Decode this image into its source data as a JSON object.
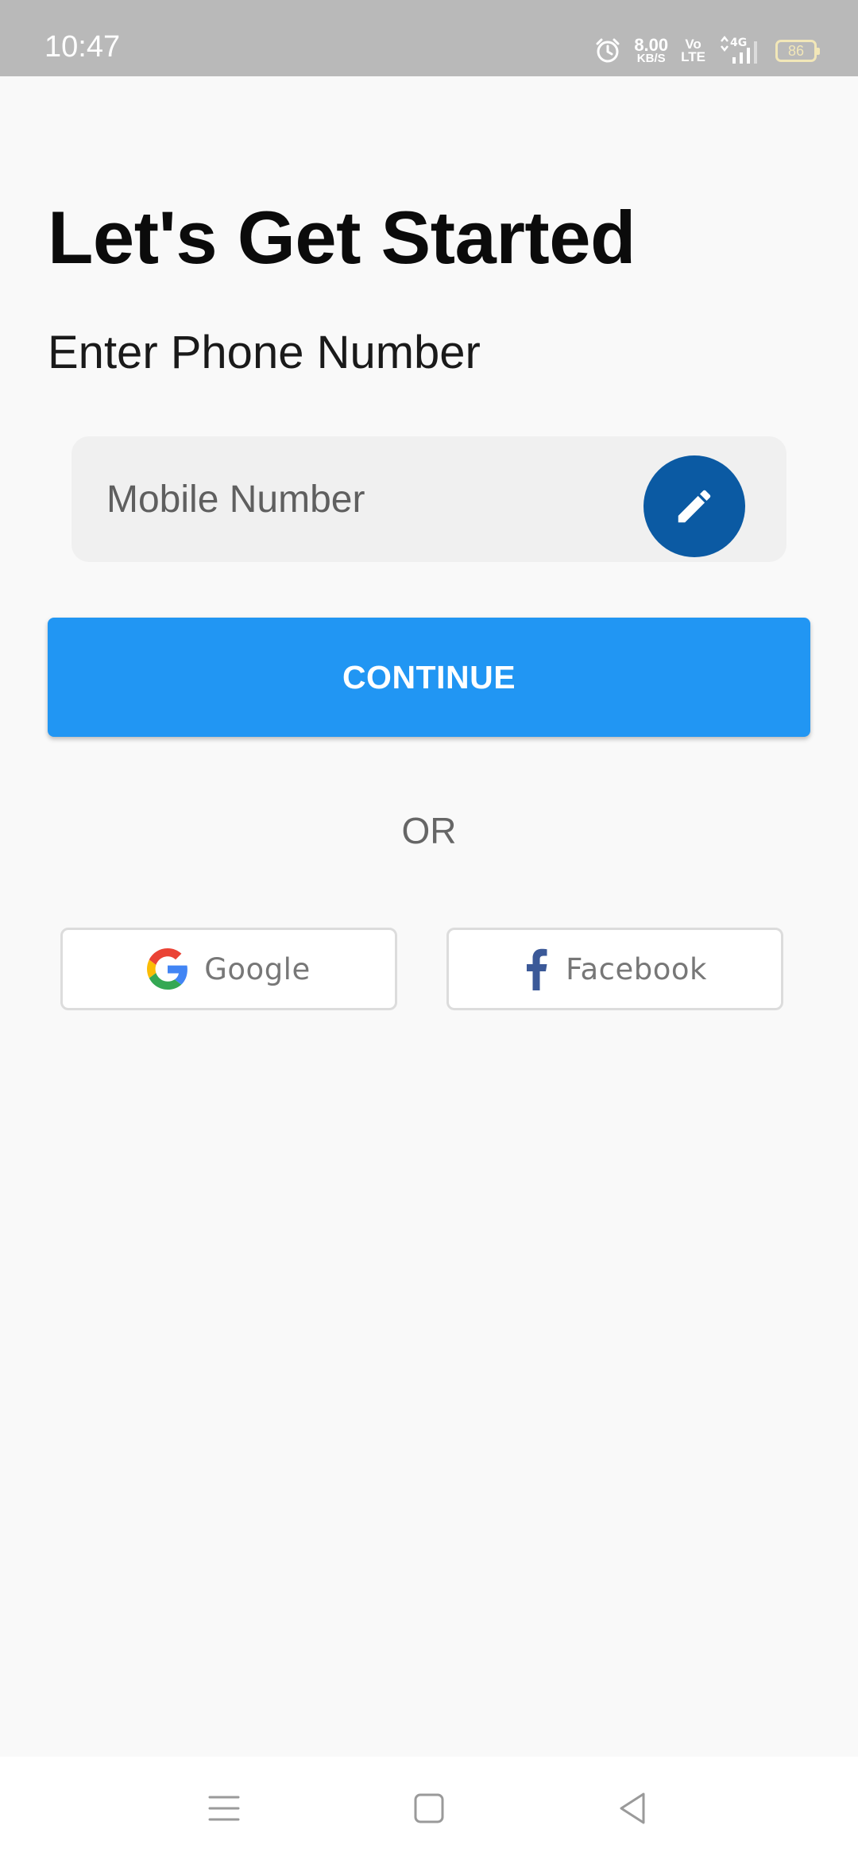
{
  "status_bar": {
    "time": "10:47",
    "net_speed_value": "8.00",
    "net_speed_unit": "KB/S",
    "volte_top": "Vo",
    "volte_bottom": "LTE",
    "network": "4G",
    "battery": "86"
  },
  "header": {
    "title": "Let's Get Started",
    "subtitle": "Enter Phone Number"
  },
  "form": {
    "mobile_placeholder": "Mobile Number",
    "mobile_value": "",
    "continue_label": "CONTINUE"
  },
  "divider": {
    "or_label": "OR"
  },
  "social": {
    "google_label": "Google",
    "facebook_label": "Facebook"
  },
  "colors": {
    "status_bar": "#b9b9b9",
    "background": "#f9f9f9",
    "primary_button": "#2196f3",
    "edit_button": "#0b5aa3",
    "facebook_blue": "#3b5998"
  },
  "icons": {
    "status": [
      "alarm-icon",
      "signal-icon",
      "battery-icon"
    ],
    "edit": "pencil-icon",
    "google": "google-icon",
    "facebook": "facebook-icon",
    "nav": [
      "menu-icon",
      "home-icon",
      "back-icon"
    ]
  }
}
